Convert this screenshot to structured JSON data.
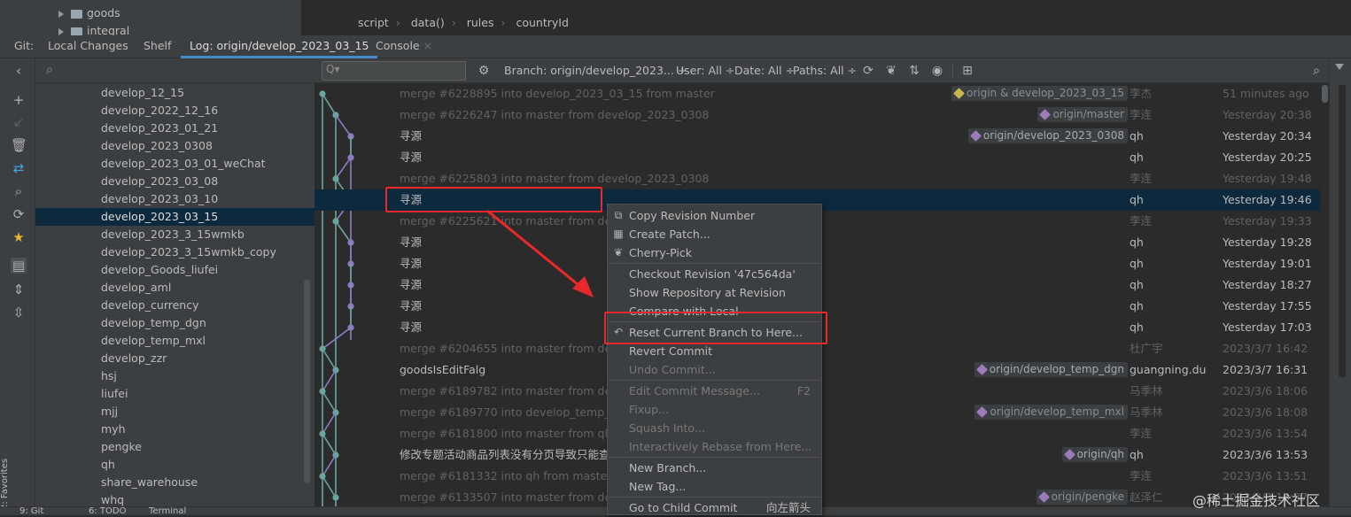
{
  "project_tree": {
    "items": [
      {
        "label": "goods"
      },
      {
        "label": "integral"
      }
    ]
  },
  "breadcrumb": [
    "script",
    "data()",
    "rules",
    "countryId"
  ],
  "tool_tabs": {
    "prefix": "Git:",
    "tabs": [
      "Local Changes",
      "Shelf",
      "Log: origin/develop_2023_03_15",
      "Console"
    ],
    "active": "Log: origin/develop_2023_03_15"
  },
  "branches": [
    "develop_12_15",
    "develop_2022_12_16",
    "develop_2023_01_21",
    "develop_2023_0308",
    "develop_2023_03_01_weChat",
    "develop_2023_03_08",
    "develop_2023_03_10",
    "develop_2023_03_15",
    "develop_2023_3_15wmkb",
    "develop_2023_3_15wmkb_copy",
    "develop_Goods_liufei",
    "develop_aml",
    "develop_currency",
    "develop_temp_dgn",
    "develop_temp_mxl",
    "develop_zzr",
    "hsj",
    "liufei",
    "mjj",
    "myh",
    "pengke",
    "qh",
    "share_warehouse",
    "whq"
  ],
  "selected_branch": "develop_2023_03_15",
  "log_toolbar": {
    "search_placeholder": "Q▾",
    "filters": {
      "branch": "Branch: origin/develop_2023... ÷",
      "user": "User: All ÷",
      "date": "Date: All ÷",
      "paths": "Paths: All ÷"
    }
  },
  "commits": [
    {
      "msg": "merge #6228895 into develop_2023_03_15 from master",
      "refs": [
        "origin & develop_2023_03_15"
      ],
      "author": "李杰",
      "date": "51 minutes ago",
      "dim": true
    },
    {
      "msg": "merge #6226247 into master from develop_2023_0308",
      "refs": [
        "origin/master"
      ],
      "author": "李连",
      "date": "Yesterday 20:38",
      "dim": true
    },
    {
      "msg": "寻源",
      "refs": [
        "origin/develop_2023_0308"
      ],
      "author": "qh",
      "date": "Yesterday 20:34",
      "dim": false
    },
    {
      "msg": "寻源",
      "refs": [],
      "author": "qh",
      "date": "Yesterday 20:25",
      "dim": false
    },
    {
      "msg": "merge #6225803 into master from develop_2023_0308",
      "refs": [],
      "author": "李连",
      "date": "Yesterday 19:48",
      "dim": true
    },
    {
      "msg": "寻源",
      "refs": [],
      "author": "qh",
      "date": "Yesterday 19:46",
      "dim": false,
      "selected": true
    },
    {
      "msg": "merge #6225621 into master from devel",
      "refs": [],
      "author": "李连",
      "date": "Yesterday 19:33",
      "dim": true
    },
    {
      "msg": "寻源",
      "refs": [],
      "author": "qh",
      "date": "Yesterday 19:28",
      "dim": false
    },
    {
      "msg": "寻源",
      "refs": [],
      "author": "qh",
      "date": "Yesterday 19:01",
      "dim": false
    },
    {
      "msg": "寻源",
      "refs": [],
      "author": "qh",
      "date": "Yesterday 18:27",
      "dim": false
    },
    {
      "msg": "寻源",
      "refs": [],
      "author": "qh",
      "date": "Yesterday 17:55",
      "dim": false
    },
    {
      "msg": "寻源",
      "refs": [],
      "author": "qh",
      "date": "Yesterday 17:03",
      "dim": false
    },
    {
      "msg": "merge #6204655 into master from devel",
      "refs": [],
      "author": "杜广宇",
      "date": "2023/3/7 16:42",
      "dim": true
    },
    {
      "msg": "goodsIsEditFalg",
      "refs": [
        "origin/develop_temp_dgn"
      ],
      "author": "guangning.du",
      "date": "2023/3/7 16:31",
      "dim": false
    },
    {
      "msg": "merge #6189782 into master from devel",
      "refs": [],
      "author": "马季林",
      "date": "2023/3/6 18:06",
      "dim": true
    },
    {
      "msg": "merge #6189770 into develop_temp_mxl",
      "refs": [
        "origin/develop_temp_mxl"
      ],
      "author": "马季林",
      "date": "2023/3/6 18:08",
      "dim": true
    },
    {
      "msg": "merge #6181800 into master from qh",
      "refs": [],
      "author": "李连",
      "date": "2023/3/6 13:54",
      "dim": true
    },
    {
      "msg": "修改专题活动商品列表没有分页导致只能查到",
      "refs": [
        "origin/qh"
      ],
      "author": "qh",
      "date": "2023/3/6 13:53",
      "dim": false
    },
    {
      "msg": "merge #6181332 into qh from master",
      "refs": [],
      "author": "李连",
      "date": "2023/3/6 13:51",
      "dim": true
    },
    {
      "msg": "merge #6133507 into master from devel",
      "refs": [
        "origin/pengke"
      ],
      "author": "赵泽仁",
      "date": "2023/3/3 16:37",
      "dim": true
    }
  ],
  "context_menu": {
    "items": [
      {
        "label": "Copy Revision Number",
        "icon": "copy-icon",
        "disabled": false
      },
      {
        "label": "Create Patch...",
        "icon": "patch-icon",
        "disabled": false
      },
      {
        "label": "Cherry-Pick",
        "icon": "cherry-icon",
        "disabled": false
      },
      {
        "sep": true
      },
      {
        "label": "Checkout Revision '47c564da'",
        "disabled": false
      },
      {
        "label": "Show Repository at Revision",
        "disabled": false
      },
      {
        "label": "Compare with Local",
        "disabled": false
      },
      {
        "sep": true
      },
      {
        "label": "Reset Current Branch to Here...",
        "icon": "undo-icon",
        "disabled": false
      },
      {
        "label": "Revert Commit",
        "disabled": false
      },
      {
        "label": "Undo Commit...",
        "disabled": true
      },
      {
        "sep": true
      },
      {
        "label": "Edit Commit Message...",
        "disabled": true,
        "shortcut": "F2"
      },
      {
        "label": "Fixup...",
        "disabled": true
      },
      {
        "label": "Squash Into...",
        "disabled": true
      },
      {
        "label": "Interactively Rebase from Here...",
        "disabled": true
      },
      {
        "sep": true
      },
      {
        "label": "New Branch...",
        "disabled": false
      },
      {
        "label": "New Tag...",
        "disabled": false
      },
      {
        "sep": true
      },
      {
        "label": "Go to Child Commit",
        "disabled": false,
        "shortcut": "向左箭头"
      }
    ]
  },
  "bottom_bar": {
    "git": "9: Git",
    "todo": "6: TODO",
    "terminal": "Terminal",
    "favorites": "2: Favorites"
  },
  "watermark": "@稀土掘金技术社区",
  "colors": {
    "selection": "#0d293e",
    "red_highlight": "#e8282b",
    "graph_teal": "#6aa6a0",
    "graph_purple": "#8e7cc3"
  }
}
